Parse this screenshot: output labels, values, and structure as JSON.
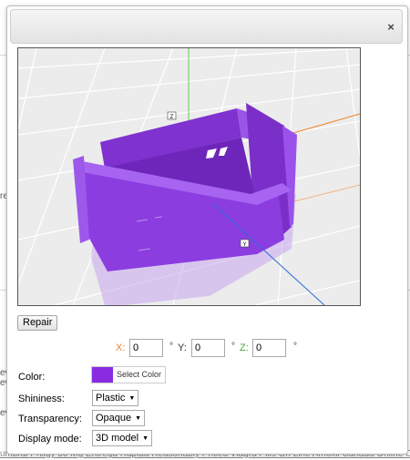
{
  "background_page": {
    "left_fragments": [
      "re",
      "ev",
      "ev",
      "ev"
    ],
    "bottom_text": "umbral Priligy 50 Mg Entrega Rapida Reasonably Priced Viagra Pills On Line Amoxil Canada Online Cialis To P"
  },
  "dialog": {
    "close_symbol": "×"
  },
  "viewer": {
    "axis_labels": {
      "z": "Z",
      "y": "Y"
    },
    "model_color": "#8a3be0",
    "background_color": "#ececec",
    "grid_color": "#ffffff",
    "axis_colors": {
      "x": "#f08020",
      "y": "#2a6bd8",
      "z": "#5dcf48"
    }
  },
  "repair_button": {
    "label": "Repair"
  },
  "coordinates": {
    "x_label": "X:",
    "x_value": "0",
    "y_label": "Y:",
    "y_value": "0",
    "z_label": "Z:",
    "z_value": "0",
    "degree_symbol": "°"
  },
  "settings": {
    "color_label": "Color:",
    "color_value": "#8a2be2",
    "select_color_label": "Select Color",
    "shininess_label": "Shininess:",
    "shininess_value": "Plastic",
    "transparency_label": "Transparency:",
    "transparency_value": "Opaque",
    "display_mode_label": "Display mode:",
    "display_mode_value": "3D model",
    "dropdown_arrow": "▼"
  }
}
